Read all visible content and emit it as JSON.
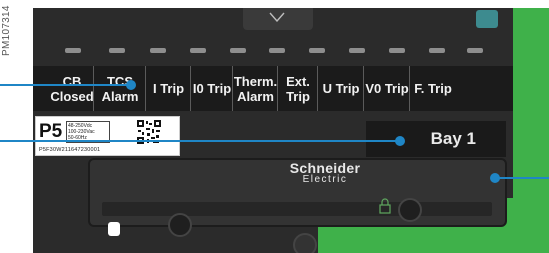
{
  "figure_code": "PM107314",
  "trip_labels": {
    "cb_closed": [
      "CB",
      "Closed"
    ],
    "tcs_alarm": [
      "TCS",
      "Alarm"
    ],
    "i_trip": "I Trip",
    "i0_trip": "I0 Trip",
    "therm_alarm": [
      "Therm.",
      "Alarm"
    ],
    "ext_trip": [
      "Ext.",
      "Trip"
    ],
    "u_trip": "U Trip",
    "v0_trip": "V0 Trip",
    "f_trip": "F. Trip"
  },
  "id_label": {
    "model": "P5",
    "specs": [
      "48-250Vdc",
      "100-230Vac",
      "50-60Hz"
    ],
    "serial": "P5F30W211647230001"
  },
  "bay_label": "Bay 1",
  "brand": {
    "name": "Schneider",
    "sub": "Electric"
  },
  "colors": {
    "callout": "#1f86c6",
    "green_panel": "#3fb14a",
    "housing": "#2b2b2b"
  },
  "icons": [
    "chevron-down-icon",
    "qr-code-icon",
    "screw-icon",
    "lock-icon"
  ]
}
